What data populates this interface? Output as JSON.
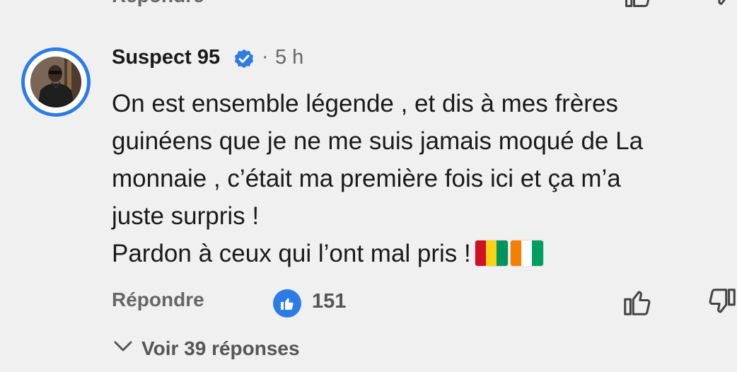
{
  "previous_comment": {
    "reply_label": "Répondre"
  },
  "comment": {
    "author": "Suspect 95",
    "verified_icon": "verified-badge-icon",
    "separator": "·",
    "time": "5 h",
    "body_lines": [
      "On est ensemble légende  , et dis à mes frères",
      "guinéens que je ne me suis jamais moqué de La",
      "monnaie , c’était ma première fois  ici et ça m’a",
      "juste surpris !",
      "Pardon à ceux qui l’ont mal pris !"
    ],
    "flags": [
      {
        "name": "guinea-flag",
        "colors": [
          "#ce1126",
          "#fcd116",
          "#009460"
        ]
      },
      {
        "name": "cote-divoire-flag",
        "colors": [
          "#f77f00",
          "#ffffff",
          "#009e60"
        ]
      }
    ],
    "reply_label": "Répondre",
    "like_count": "151",
    "view_replies": "Voir 39 réponses"
  },
  "colors": {
    "background": "#f0f0f0",
    "accent": "#2d7be5",
    "text": "#1a1a1a",
    "muted": "#666666"
  }
}
